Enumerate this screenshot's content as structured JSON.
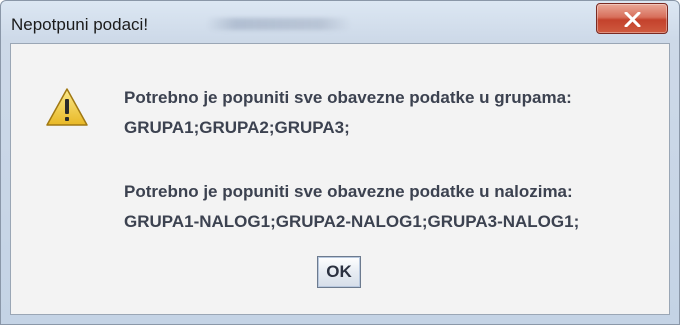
{
  "window": {
    "title": "Nepotpuni podaci!"
  },
  "icons": {
    "dialog": "warning-triangle-icon",
    "close": "close-x-icon"
  },
  "message": {
    "groups_label": "Potrebno je popuniti sve obavezne podatke u grupama:",
    "groups_value": "GRUPA1;GRUPA2;GRUPA3;",
    "orders_label": "Potrebno je popuniti sve obavezne podatke u nalozima:",
    "orders_value": "GRUPA1-NALOG1;GRUPA2-NALOG1;GRUPA3-NALOG1;"
  },
  "buttons": {
    "ok_label": "OK"
  },
  "colors": {
    "close_button": "#c4422c",
    "warning_fill": "#f2d14a",
    "message_text": "#3c4250"
  }
}
